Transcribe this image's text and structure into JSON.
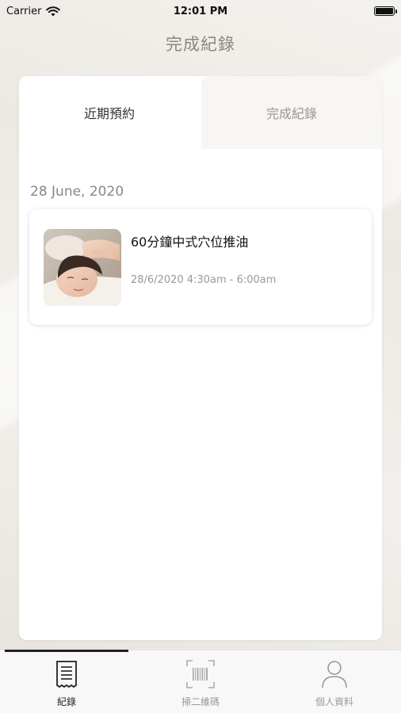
{
  "status_bar": {
    "carrier": "Carrier",
    "time": "12:01 PM"
  },
  "nav": {
    "title": "完成紀錄"
  },
  "tabs": [
    {
      "label": "近期預約",
      "active": true
    },
    {
      "label": "完成紀錄",
      "active": false
    }
  ],
  "records": {
    "date": "28 June, 2020",
    "items": [
      {
        "title": "60分鐘中式穴位推油",
        "time": "28/6/2020 4:30am - 6:00am",
        "thumbnail": "massage-photo"
      }
    ]
  },
  "tabbar": {
    "items": [
      {
        "label": "紀錄",
        "icon": "receipt-icon",
        "active": true
      },
      {
        "label": "掃二維碼",
        "icon": "barcode-scan-icon",
        "active": false
      },
      {
        "label": "個人資料",
        "icon": "person-icon",
        "active": false
      }
    ]
  }
}
